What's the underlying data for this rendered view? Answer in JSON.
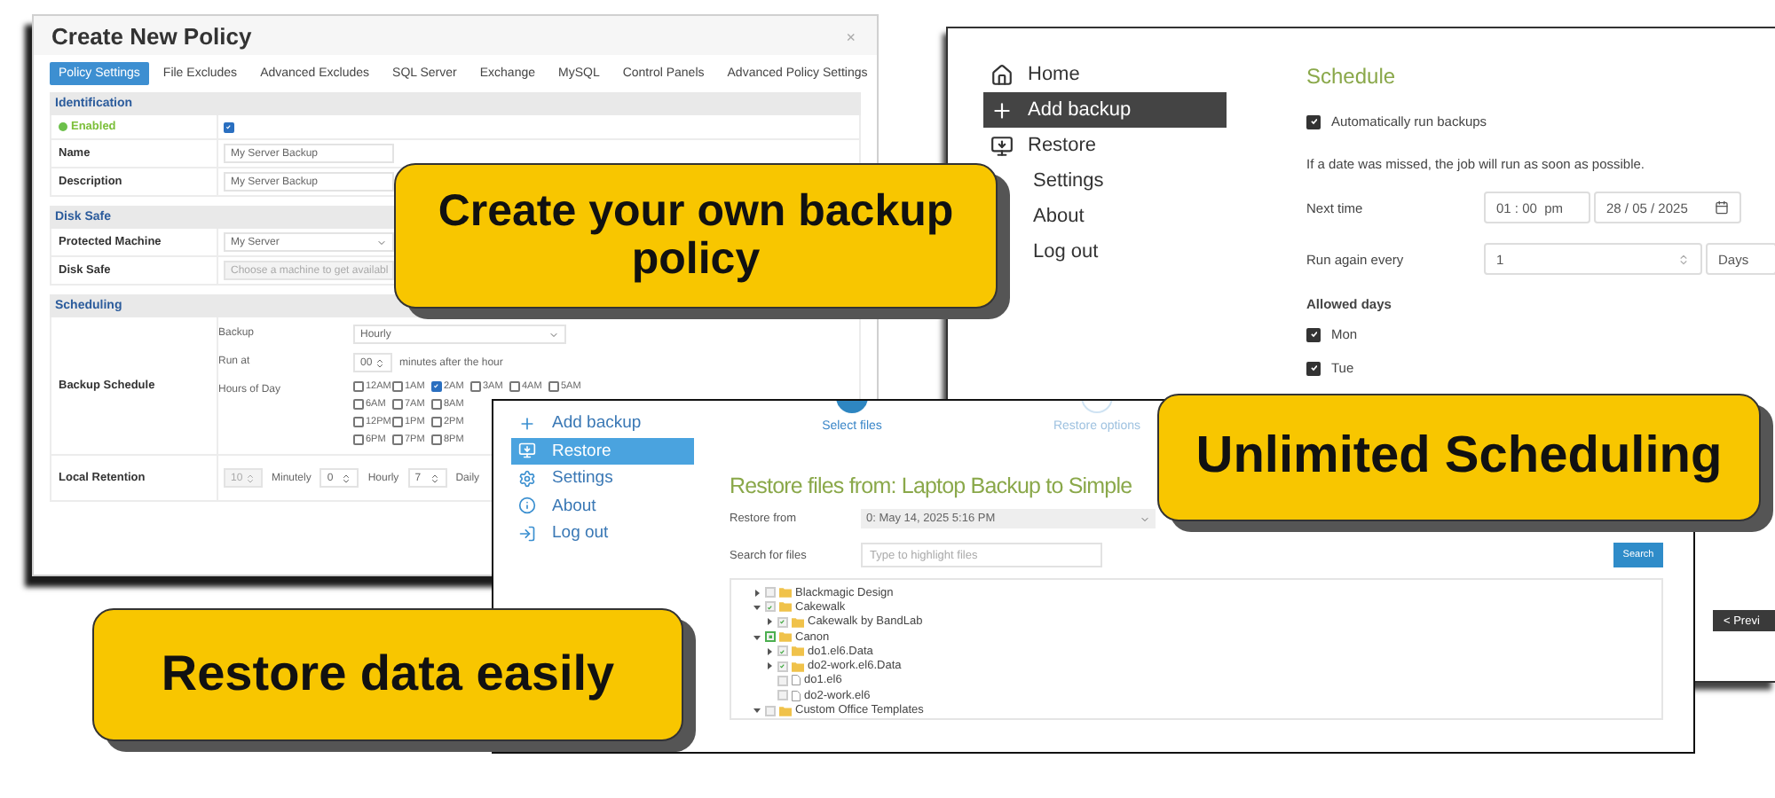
{
  "policy_window": {
    "title": "Create New Policy",
    "close": "×",
    "tabs": [
      {
        "label": "Policy Settings",
        "selected": true
      },
      {
        "label": "File Excludes",
        "selected": false
      },
      {
        "label": "Advanced Excludes",
        "selected": false
      },
      {
        "label": "SQL Server",
        "selected": false
      },
      {
        "label": "Exchange",
        "selected": false
      },
      {
        "label": "MySQL",
        "selected": false
      },
      {
        "label": "Control Panels",
        "selected": false
      },
      {
        "label": "Advanced Policy Settings",
        "selected": false
      }
    ],
    "sections": [
      {
        "title": "Identification",
        "rows": [
          {
            "kind": "toggle",
            "label": "Enabled",
            "checked": true
          },
          {
            "kind": "text",
            "label": "Name",
            "value": "My Server Backup"
          },
          {
            "kind": "text",
            "label": "Description",
            "value": "My Server Backup"
          }
        ]
      },
      {
        "title": "Disk Safe",
        "rows": [
          {
            "kind": "select",
            "label": "Protected Machine",
            "value": "My Server",
            "disabled": false
          },
          {
            "kind": "select",
            "label": "Disk Safe",
            "placeholder": "Choose a machine to get availabl",
            "disabled": true
          }
        ]
      },
      {
        "title": "Scheduling",
        "rows": [
          {
            "kind": "schedule",
            "label": "Backup Schedule",
            "backup_label": "Backup",
            "backup_value": "Hourly",
            "run_at_label": "Run at",
            "run_at_value": "00",
            "run_at_suffix": "minutes after the hour",
            "hours_label": "Hours of Day",
            "hours": [
              {
                "items": [
                  {
                    "label": "12AM",
                    "checked": false
                  },
                  {
                    "label": "1AM",
                    "checked": false
                  },
                  {
                    "label": "2AM",
                    "checked": true
                  },
                  {
                    "label": "3AM",
                    "checked": false
                  },
                  {
                    "label": "4AM",
                    "checked": false
                  },
                  {
                    "label": "5AM",
                    "checked": false
                  }
                ]
              },
              {
                "items": [
                  {
                    "label": "6AM",
                    "checked": false
                  },
                  {
                    "label": "7AM",
                    "checked": false
                  },
                  {
                    "label": "8AM",
                    "checked": false
                  }
                ]
              },
              {
                "items": [
                  {
                    "label": "12PM",
                    "checked": false
                  },
                  {
                    "label": "1PM",
                    "checked": false
                  },
                  {
                    "label": "2PM",
                    "checked": false
                  }
                ]
              },
              {
                "items": [
                  {
                    "label": "6PM",
                    "checked": false
                  },
                  {
                    "label": "7PM",
                    "checked": false
                  },
                  {
                    "label": "8PM",
                    "checked": false
                  }
                ]
              }
            ]
          },
          {
            "kind": "retention",
            "label": "Local Retention",
            "fields": [
              {
                "value": "10",
                "unit": "Minutely",
                "disabled": true
              },
              {
                "value": "0",
                "unit": "Hourly",
                "disabled": false
              },
              {
                "value": "7",
                "unit": "Daily",
                "disabled": false
              }
            ]
          }
        ]
      }
    ]
  },
  "schedule_window": {
    "nav": [
      {
        "label": "Home",
        "selected": false
      },
      {
        "label": "Add backup",
        "selected": true
      },
      {
        "label": "Restore",
        "selected": false
      },
      {
        "label": "Settings",
        "selected": false
      },
      {
        "label": "About",
        "selected": false
      },
      {
        "label": "Log out",
        "selected": false
      }
    ],
    "heading": "Schedule",
    "auto_run": {
      "label": "Automatically run backups",
      "checked": true
    },
    "note": "If a date was missed, the job will run as soon as possible.",
    "next_time": {
      "label": "Next time",
      "time": "01 : 00  pm",
      "date": "28 / 05 / 2025"
    },
    "run_again": {
      "label": "Run again every",
      "value": "1",
      "unit": "Days"
    },
    "allowed_days": {
      "label": "Allowed days",
      "days": [
        {
          "label": "Mon",
          "checked": true
        },
        {
          "label": "Tue",
          "checked": true
        }
      ]
    },
    "prev_button": "< Previ"
  },
  "restore_window": {
    "nav": [
      {
        "label": "Add backup",
        "selected": false
      },
      {
        "label": "Restore",
        "selected": true
      },
      {
        "label": "Settings",
        "selected": false
      },
      {
        "label": "About",
        "selected": false
      },
      {
        "label": "Log out",
        "selected": false
      }
    ],
    "steps": [
      {
        "label": "Select files",
        "selected": true
      },
      {
        "label": "Restore options",
        "selected": false
      }
    ],
    "title": "Restore files from: Laptop Backup to Simple",
    "restore_from": {
      "label": "Restore from",
      "value": "0: May 14, 2025 5:16 PM"
    },
    "search": {
      "label": "Search for files",
      "placeholder": "Type to highlight files",
      "button": "Search"
    },
    "tree": [
      {
        "kind": "folder",
        "label": "Blackmagic Design",
        "checked": false,
        "partial": false,
        "expanded": false
      },
      {
        "kind": "folder",
        "label": "Cakewalk",
        "checked": true,
        "partial": false,
        "expanded": true,
        "children": [
          {
            "kind": "folder",
            "label": "Cakewalk by BandLab",
            "checked": true,
            "partial": false,
            "expanded": false
          }
        ]
      },
      {
        "kind": "folder",
        "label": "Canon",
        "checked": false,
        "partial": true,
        "expanded": true,
        "children": [
          {
            "kind": "folder",
            "label": "do1.el6.Data",
            "checked": true,
            "partial": false,
            "expanded": false
          },
          {
            "kind": "folder",
            "label": "do2-work.el6.Data",
            "checked": true,
            "partial": false,
            "expanded": false
          },
          {
            "kind": "file",
            "label": "do1.el6",
            "checked": false,
            "partial": false
          },
          {
            "kind": "file",
            "label": "do2-work.el6",
            "checked": false,
            "partial": false
          }
        ]
      },
      {
        "kind": "folder",
        "label": "Custom Office Templates",
        "checked": false,
        "partial": false,
        "expanded": true
      }
    ]
  },
  "callouts": [
    {
      "text": "Create your own backup policy"
    },
    {
      "text": "Unlimited Scheduling"
    },
    {
      "text": "Restore data easily"
    }
  ]
}
